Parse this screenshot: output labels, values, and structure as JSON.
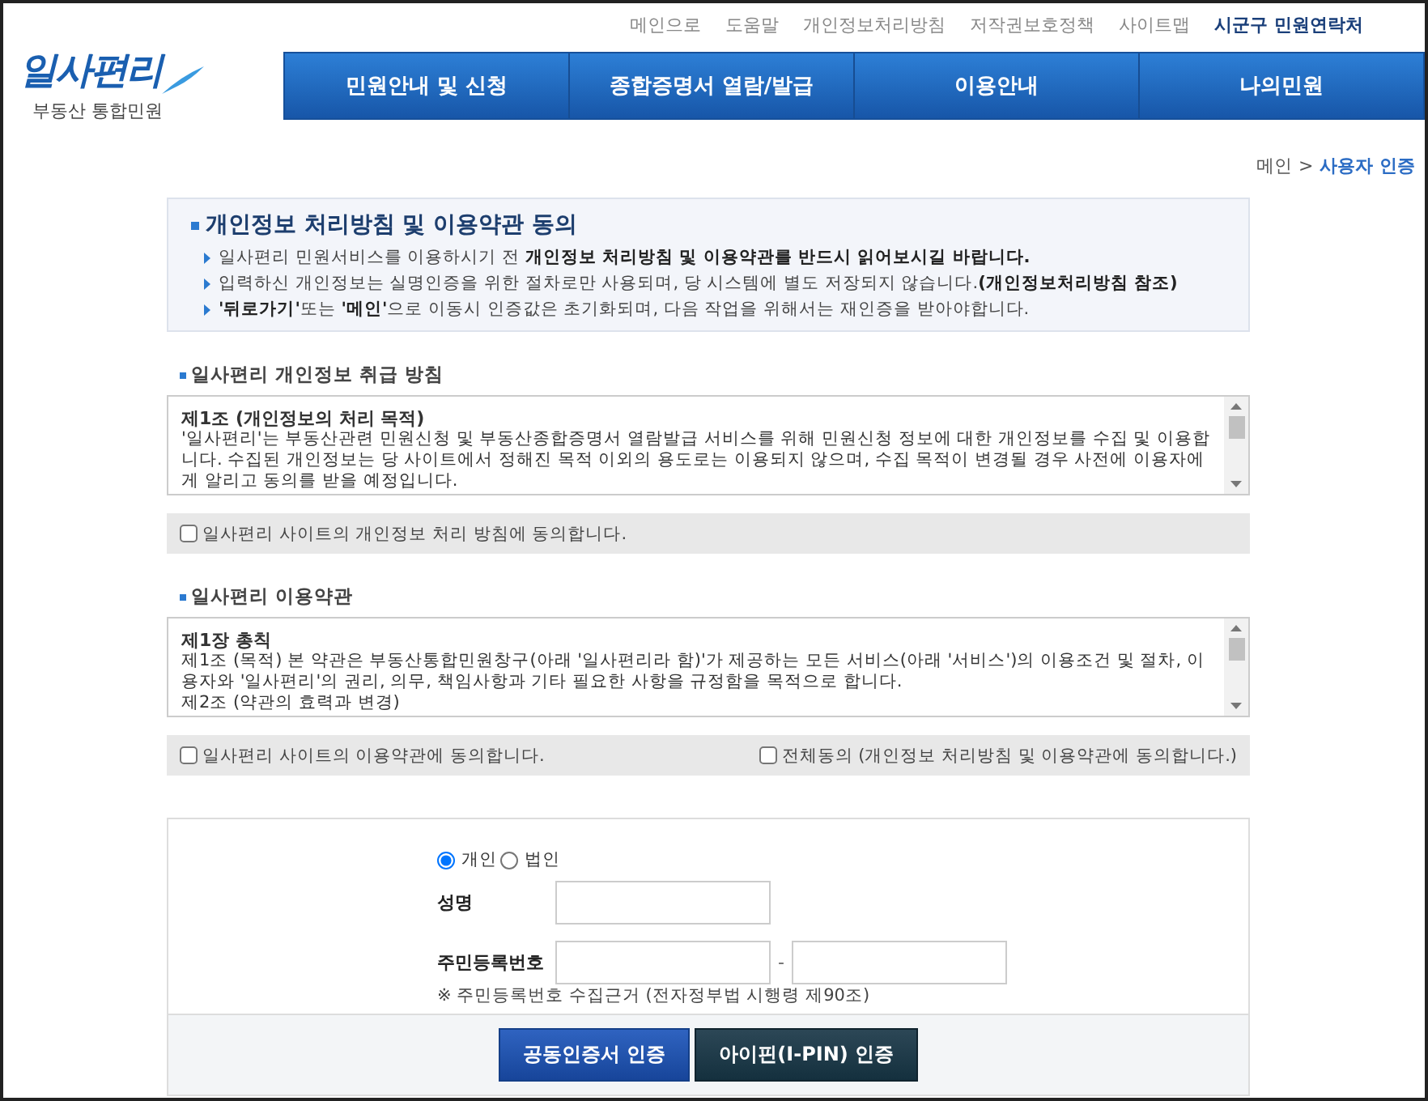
{
  "top_links": [
    {
      "label": "메인으로",
      "highlight": false
    },
    {
      "label": "도움말",
      "highlight": false
    },
    {
      "label": "개인정보처리방침",
      "highlight": false
    },
    {
      "label": "저작권보호정책",
      "highlight": false
    },
    {
      "label": "사이트맵",
      "highlight": false
    },
    {
      "label": "시군구 민원연락처",
      "highlight": true
    }
  ],
  "logo": {
    "name": "일사편리",
    "subtitle": "부동산 통합민원"
  },
  "nav": [
    "민원안내 및 신청",
    "종합증명서 열람/발급",
    "이용안내",
    "나의민원"
  ],
  "breadcrumb": {
    "home": "메인",
    "separator": ">",
    "current": "사용자 인증"
  },
  "notice": {
    "title": "개인정보 처리방침 및 이용약관 동의",
    "lines": [
      "일사편리 민원서비스를 이용하시기 전 **개인정보 처리방침 및 이용약관를 반드시 읽어보시길 바랍니다.**",
      "입력하신 개인정보는 실명인증을 위한 절차로만 사용되며, 당 시스템에 별도 저장되지 않습니다.**(개인정보처리방침 참조)**",
      "**'뒤로가기'**또는 **'메인'**으로 이동시 인증값은 초기화되며, 다음 작업을 위해서는 재인증을 받아야합니다."
    ]
  },
  "sections": [
    {
      "title": "일사편리 개인정보 취급 방침",
      "heading": "제1조 (개인정보의 처리 목적)",
      "paragraphs": [
        "'일사편리'는 부동산관련 민원신청 및 부동산종합증명서 열람발급 서비스를 위해 민원신청 정보에 대한 개인정보를 수집 및 이용합니다. 수집된 개인정보는 당 사이트에서 정해진 목적 이외의 용도로는 이용되지 않으며, 수집 목적이 변경될 경우 사전에 이용자에게 알리고 동의를 받을 예정입니다."
      ],
      "agreements": [
        {
          "label": "일사편리 사이트의 개인정보 처리 방침에 동의합니다.",
          "checked": false
        }
      ]
    },
    {
      "title": "일사편리 이용약관",
      "heading": "제1장 총칙",
      "paragraphs": [
        "제1조 (목적) 본 약관은 부동산통합민원창구(아래 '일사편리라 함)'가 제공하는 모든 서비스(아래 '서비스')의 이용조건 및 절차, 이용자와 '일사편리'의 권리, 의무, 책임사항과 기타 필요한 사항을 규정함을 목적으로 합니다.",
        "제2조 (약관의 효력과 변경)"
      ],
      "agreements": [
        {
          "label": "일사편리 사이트의 이용약관에 동의합니다.",
          "checked": false
        },
        {
          "label": "전체동의 (개인정보 처리방침 및 이용약관에 동의합니다.)",
          "checked": false
        }
      ]
    }
  ],
  "form": {
    "types": [
      {
        "label": "개인",
        "selected": true
      },
      {
        "label": "법인",
        "selected": false
      }
    ],
    "name_label": "성명",
    "rrn_label": "주민등록번호",
    "rrn_separator": "-",
    "note": "※ 주민등록번호 수집근거 (전자정부법 시행령 제90조)",
    "buttons": [
      {
        "label": "공동인증서 인증",
        "kind": "primary"
      },
      {
        "label": "아이핀(I-PIN) 인증",
        "kind": "dark"
      }
    ]
  }
}
